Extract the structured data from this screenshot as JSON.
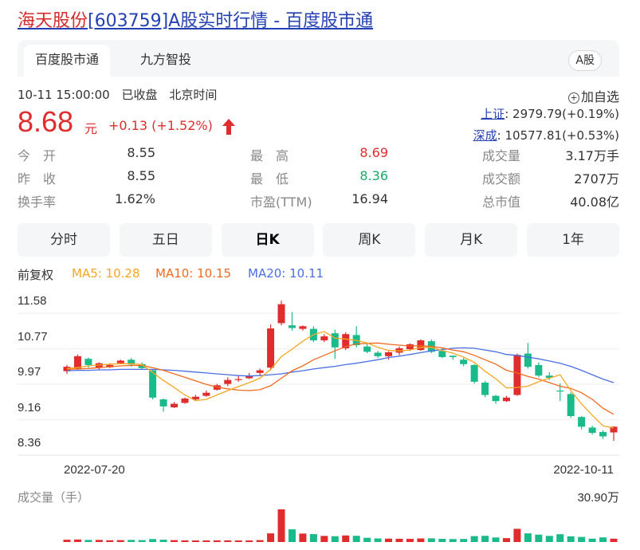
{
  "header": {
    "title_part1": "海天股份",
    "title_part2": "[603759]A股实时行情 - 百度股市通"
  },
  "tabs": [
    "百度股市通",
    "九方智投"
  ],
  "market_badge": "A股",
  "quote": {
    "time": "10-11 15:00:00",
    "status": "已收盘",
    "timezone": "北京时间",
    "price": "8.68",
    "unit": "元",
    "change": "+0.13 (+1.52%)",
    "add_watchlist": "加自选"
  },
  "indices": [
    {
      "name": "上证",
      "value": ": 2979.79(+0.19%)"
    },
    {
      "name": "深成",
      "value": ": 10577.81(+0.53%)"
    }
  ],
  "stats": [
    {
      "label": "今　开",
      "value": "8.55",
      "tone": "normal"
    },
    {
      "label": "最　高",
      "value": "8.69",
      "tone": "red"
    },
    {
      "label": "成交量",
      "value": "3.17万手",
      "tone": "normal"
    },
    {
      "label": "昨　收",
      "value": "8.55",
      "tone": "normal"
    },
    {
      "label": "最　低",
      "value": "8.36",
      "tone": "green"
    },
    {
      "label": "成交额",
      "value": "2707万",
      "tone": "normal"
    },
    {
      "label": "换手率",
      "value": "1.62%",
      "tone": "normal"
    },
    {
      "label": "市盈(TTM)",
      "value": "16.94",
      "tone": "normal"
    },
    {
      "label": "总市值",
      "value": "40.08亿",
      "tone": "normal"
    }
  ],
  "period_tabs": [
    "分时",
    "五日",
    "日K",
    "周K",
    "月K",
    "1年"
  ],
  "active_period": "日K",
  "adjust_label": "前复权",
  "ma_legend": [
    {
      "label": "MA5: 10.28",
      "color": "#f5a623"
    },
    {
      "label": "MA10: 10.15",
      "color": "#f06a1e"
    },
    {
      "label": "MA20: 10.11",
      "color": "#4a6fe3"
    }
  ],
  "colors": {
    "up": "#e02c2c",
    "down": "#1aba8a",
    "link": "#2440b3"
  },
  "chart_data": {
    "type": "candlestick",
    "y_ticks": [
      "11.58",
      "10.77",
      "9.97",
      "9.16",
      "8.36"
    ],
    "ylim": [
      8.36,
      11.58
    ],
    "x_labels": [
      "2022-07-20",
      "2022-10-11"
    ],
    "volume_label": "成交量（手）",
    "volume_max_label": "30.90万",
    "candles": [
      {
        "o": 9.94,
        "c": 10.04,
        "h": 10.08,
        "l": 9.88
      },
      {
        "o": 9.98,
        "c": 10.28,
        "h": 10.32,
        "l": 9.95
      },
      {
        "o": 10.22,
        "c": 10.08,
        "h": 10.25,
        "l": 10.02
      },
      {
        "o": 10.02,
        "c": 10.12,
        "h": 10.14,
        "l": 9.97
      },
      {
        "o": 10.03,
        "c": 10.08,
        "h": 10.12,
        "l": 10.01
      },
      {
        "o": 10.12,
        "c": 10.18,
        "h": 10.2,
        "l": 10.1
      },
      {
        "o": 10.2,
        "c": 10.09,
        "h": 10.24,
        "l": 10.04
      },
      {
        "o": 10.1,
        "c": 10.01,
        "h": 10.14,
        "l": 9.98
      },
      {
        "o": 9.96,
        "c": 9.34,
        "h": 9.98,
        "l": 9.3
      },
      {
        "o": 9.3,
        "c": 9.14,
        "h": 9.32,
        "l": 9.02
      },
      {
        "o": 9.12,
        "c": 9.2,
        "h": 9.24,
        "l": 9.1
      },
      {
        "o": 9.22,
        "c": 9.32,
        "h": 9.34,
        "l": 9.2
      },
      {
        "o": 9.3,
        "c": 9.36,
        "h": 9.4,
        "l": 9.28
      },
      {
        "o": 9.38,
        "c": 9.45,
        "h": 9.5,
        "l": 9.36
      },
      {
        "o": 9.52,
        "c": 9.62,
        "h": 9.65,
        "l": 9.5
      },
      {
        "o": 9.65,
        "c": 9.74,
        "h": 9.8,
        "l": 9.6
      },
      {
        "o": 9.74,
        "c": 9.76,
        "h": 9.84,
        "l": 9.7
      },
      {
        "o": 9.78,
        "c": 9.84,
        "h": 9.9,
        "l": 9.76
      },
      {
        "o": 9.9,
        "c": 9.96,
        "h": 10.0,
        "l": 9.84
      },
      {
        "o": 10.02,
        "c": 10.91,
        "h": 11.0,
        "l": 9.96
      },
      {
        "o": 11.03,
        "c": 11.46,
        "h": 11.54,
        "l": 10.98
      },
      {
        "o": 10.98,
        "c": 10.92,
        "h": 11.28,
        "l": 10.86
      },
      {
        "o": 10.9,
        "c": 10.96,
        "h": 10.98,
        "l": 10.86
      },
      {
        "o": 10.9,
        "c": 10.64,
        "h": 10.96,
        "l": 10.6
      },
      {
        "o": 10.64,
        "c": 10.73,
        "h": 10.78,
        "l": 10.6
      },
      {
        "o": 10.8,
        "c": 10.48,
        "h": 10.88,
        "l": 10.22
      },
      {
        "o": 10.46,
        "c": 10.78,
        "h": 10.82,
        "l": 10.42
      },
      {
        "o": 10.76,
        "c": 10.53,
        "h": 10.96,
        "l": 10.48
      },
      {
        "o": 10.5,
        "c": 10.38,
        "h": 10.56,
        "l": 10.35
      },
      {
        "o": 10.36,
        "c": 10.28,
        "h": 10.4,
        "l": 10.24
      },
      {
        "o": 10.28,
        "c": 10.37,
        "h": 10.39,
        "l": 10.2
      },
      {
        "o": 10.36,
        "c": 10.46,
        "h": 10.5,
        "l": 10.3
      },
      {
        "o": 10.44,
        "c": 10.55,
        "h": 10.57,
        "l": 10.4
      },
      {
        "o": 10.42,
        "c": 10.64,
        "h": 10.66,
        "l": 10.4
      },
      {
        "o": 10.62,
        "c": 10.38,
        "h": 10.66,
        "l": 10.35
      },
      {
        "o": 10.4,
        "c": 10.26,
        "h": 10.46,
        "l": 10.24
      },
      {
        "o": 10.29,
        "c": 10.26,
        "h": 10.3,
        "l": 10.2
      },
      {
        "o": 10.2,
        "c": 10.1,
        "h": 10.24,
        "l": 10.05
      },
      {
        "o": 10.08,
        "c": 9.7,
        "h": 10.1,
        "l": 9.66
      },
      {
        "o": 9.68,
        "c": 9.4,
        "h": 9.72,
        "l": 9.35
      },
      {
        "o": 9.38,
        "c": 9.26,
        "h": 9.4,
        "l": 9.2
      },
      {
        "o": 9.26,
        "c": 9.34,
        "h": 9.38,
        "l": 9.24
      },
      {
        "o": 9.4,
        "c": 10.31,
        "h": 10.34,
        "l": 9.38
      },
      {
        "o": 10.34,
        "c": 10.04,
        "h": 10.58,
        "l": 10.0
      },
      {
        "o": 10.08,
        "c": 9.84,
        "h": 10.14,
        "l": 9.8
      },
      {
        "o": 9.84,
        "c": 9.79,
        "h": 9.92,
        "l": 9.74
      },
      {
        "o": 9.5,
        "c": 9.48,
        "h": 9.66,
        "l": 9.26
      },
      {
        "o": 9.42,
        "c": 8.92,
        "h": 9.46,
        "l": 8.88
      },
      {
        "o": 8.9,
        "c": 8.68,
        "h": 8.92,
        "l": 8.62
      },
      {
        "o": 8.66,
        "c": 8.54,
        "h": 8.7,
        "l": 8.5
      },
      {
        "o": 8.56,
        "c": 8.46,
        "h": 8.6,
        "l": 8.4
      },
      {
        "o": 8.55,
        "c": 8.68,
        "h": 8.69,
        "l": 8.36
      }
    ],
    "volumes": [
      2.2,
      2.4,
      2.0,
      2.0,
      1.7,
      1.8,
      2.0,
      1.8,
      2.8,
      2.2,
      1.8,
      1.6,
      1.5,
      1.5,
      1.6,
      1.6,
      1.5,
      1.4,
      1.8,
      8.2,
      30.9,
      12.0,
      8.0,
      7.5,
      5.8,
      5.5,
      6.2,
      5.9,
      4.0,
      3.4,
      3.2,
      3.1,
      3.0,
      3.4,
      3.5,
      3.0,
      2.8,
      2.9,
      5.6,
      5.9,
      4.3,
      3.7,
      12.5,
      8.2,
      7.0,
      5.8,
      7.4,
      5.4,
      4.8,
      3.2,
      4.4,
      3.17
    ],
    "ma5": [
      10.0,
      10.02,
      10.06,
      10.08,
      10.1,
      10.11,
      10.11,
      10.09,
      9.91,
      9.73,
      9.57,
      9.4,
      9.27,
      9.3,
      9.4,
      9.5,
      9.59,
      9.68,
      9.78,
      9.98,
      10.27,
      10.44,
      10.62,
      10.77,
      10.84,
      10.69,
      10.67,
      10.64,
      10.58,
      10.48,
      10.41,
      10.4,
      10.42,
      10.48,
      10.48,
      10.41,
      10.35,
      10.26,
      10.14,
      9.94,
      9.77,
      9.56,
      9.57,
      9.6,
      9.7,
      9.78,
      9.86,
      9.5,
      9.2,
      8.94,
      8.7,
      8.65
    ],
    "ma10": [
      9.98,
      9.99,
      10.0,
      10.02,
      10.04,
      10.06,
      10.07,
      10.07,
      10.02,
      9.96,
      9.88,
      9.8,
      9.72,
      9.64,
      9.58,
      9.54,
      9.51,
      9.5,
      9.52,
      9.61,
      9.78,
      9.95,
      10.06,
      10.2,
      10.3,
      10.4,
      10.5,
      10.56,
      10.57,
      10.58,
      10.55,
      10.53,
      10.51,
      10.52,
      10.5,
      10.47,
      10.42,
      10.38,
      10.3,
      10.2,
      10.1,
      9.96,
      9.9,
      9.82,
      9.76,
      9.68,
      9.6,
      9.55,
      9.45,
      9.3,
      9.1,
      8.96
    ],
    "ma20": [
      9.95,
      9.96,
      9.96,
      9.97,
      9.97,
      9.98,
      9.98,
      9.98,
      9.98,
      9.97,
      9.96,
      9.94,
      9.92,
      9.9,
      9.88,
      9.86,
      9.84,
      9.83,
      9.84,
      9.86,
      9.88,
      9.92,
      9.95,
      9.99,
      10.02,
      10.05,
      10.09,
      10.12,
      10.16,
      10.2,
      10.25,
      10.28,
      10.32,
      10.36,
      10.4,
      10.43,
      10.46,
      10.47,
      10.46,
      10.42,
      10.38,
      10.32,
      10.3,
      10.26,
      10.22,
      10.17,
      10.12,
      10.05,
      9.96,
      9.86,
      9.76,
      9.68
    ]
  }
}
